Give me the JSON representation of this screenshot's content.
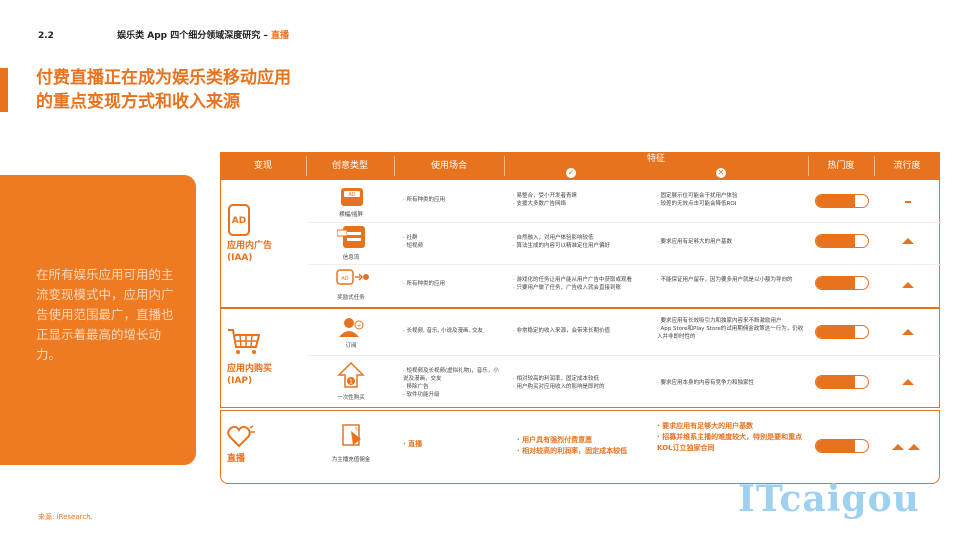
{
  "header": {
    "section": "2.2",
    "subtitle_prefix": "娱乐类 App 四个细分领域深度研究 – ",
    "subtitle_highlight": "直播"
  },
  "title": {
    "line1": "付费直播正在成为娱乐类移动应用",
    "line2": "的重点变现方式和收入来源"
  },
  "left_panel": {
    "text": "在所有娱乐应用可用的主流变现模式中，应用内广告使用范围最广，直播也正显示着最高的增长动力。"
  },
  "source": "来源: iResearch.",
  "watermark": "ITcaigou",
  "table": {
    "headers": {
      "mode": "变现",
      "creative": "创意类型",
      "usage": "使用场合",
      "feature": "特征",
      "pros_icon": "✓",
      "cons_icon": "✕",
      "heat": "热门度",
      "trend": "流行度"
    },
    "groups": [
      {
        "label": "应用内广告\n(IAA)",
        "icon": "ad-icon",
        "rows": [
          {
            "creative": "横幅/插屏",
            "usage": "· 所有种类的应用",
            "pros": "· 易整合，受小开发者青睐\n· 支援大多数广告网络",
            "cons": "· 固定展示位可能会干扰用户体验\n· 较差的无效点击可能会降低ROI",
            "heat": 0.75,
            "trend": "dash"
          },
          {
            "creative": "信息流",
            "usage": "· 社群\n· 短视频",
            "pros": "· 自然融入，对用户体验影响较低\n· 算法生成的内容可以精准定位用户偏好",
            "cons": "· 要求应用有足够大的用户基数",
            "heat": 0.75,
            "trend": "up"
          },
          {
            "creative": "奖励式任务",
            "usage": "· 所有种类的应用",
            "pros": "· 游戏化的任务让用户能从用户广告中获取或观看\n· 只要用户做了任务，广告收入就会直接到账",
            "cons": "· 不能保证用户留存，因为要多用户就是以小额为导向的",
            "heat": 0.75,
            "trend": "up"
          }
        ]
      },
      {
        "label": "应用内购买\n(IAP)",
        "icon": "shopping-cart-icon",
        "rows": [
          {
            "creative": "订阅",
            "usage": "· 长视频, 音乐, 小说及漫画, 交友",
            "pros": "· 非常稳定的收入来源，会带来长期价值",
            "cons": "· 要求应用有长效吸引力和独家内容来不断激励用户\n· App Store和Play Store的试用期佣金政策这一行为，仍收入并非即时性的",
            "heat": 0.75,
            "trend": "up"
          },
          {
            "creative": "一次性购买",
            "usage": "· 短视频及长视频(虚拟礼物)，音乐，小说及漫画，交友\n· 移除广告\n· 软件功能升级",
            "pros": "· 相对较高的利润率，固定成本较低\n· 用户购买对应用收入的影响是即时的",
            "cons": "· 要求应用本身的内容有竞争力和独家性",
            "heat": 0.75,
            "trend": "up"
          }
        ]
      },
      {
        "label": "直播",
        "icon": "heart-icon",
        "rows": [
          {
            "creative": "为主播充值佣金",
            "usage": "· 直播",
            "pros": "· 用户具有强烈付费意愿\n· 相对较高的利润率，固定成本较低",
            "cons": "· 要求应用有足够大的用户基数\n· 招募并维系主播的难度较大，特别是要和重点KOL订立独家合同",
            "heat": 0.75,
            "trend": "up-up"
          }
        ]
      }
    ]
  }
}
